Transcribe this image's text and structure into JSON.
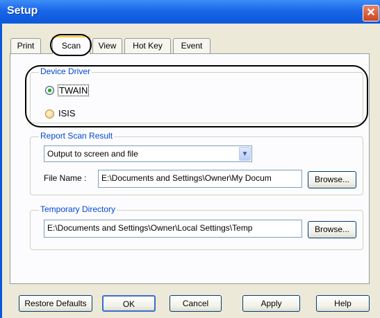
{
  "window": {
    "title": "Setup",
    "close_glyph": "✕"
  },
  "tabs": [
    {
      "label": "Print"
    },
    {
      "label": "Scan"
    },
    {
      "label": "View"
    },
    {
      "label": "Hot Key"
    },
    {
      "label": "Event"
    }
  ],
  "device_driver": {
    "legend": "Device Driver",
    "options": [
      {
        "label": "TWAIN",
        "selected": true
      },
      {
        "label": "ISIS",
        "selected": false
      }
    ]
  },
  "report": {
    "legend": "Report Scan Result",
    "output_value": "Output to screen and file",
    "file_name_label": "File Name :",
    "file_name_value": "E:\\Documents and Settings\\Owner\\My Docum",
    "browse_label": "Browse..."
  },
  "temp_dir": {
    "legend": "Temporary Directory",
    "path_value": "E:\\Documents and Settings\\Owner\\Local Settings\\Temp",
    "browse_label": "Browse..."
  },
  "buttons": {
    "restore": "Restore Defaults",
    "ok": "OK",
    "cancel": "Cancel",
    "apply": "Apply",
    "help": "Help"
  },
  "icons": {
    "close": "close-icon",
    "dropdown": "chevron-down-icon"
  }
}
